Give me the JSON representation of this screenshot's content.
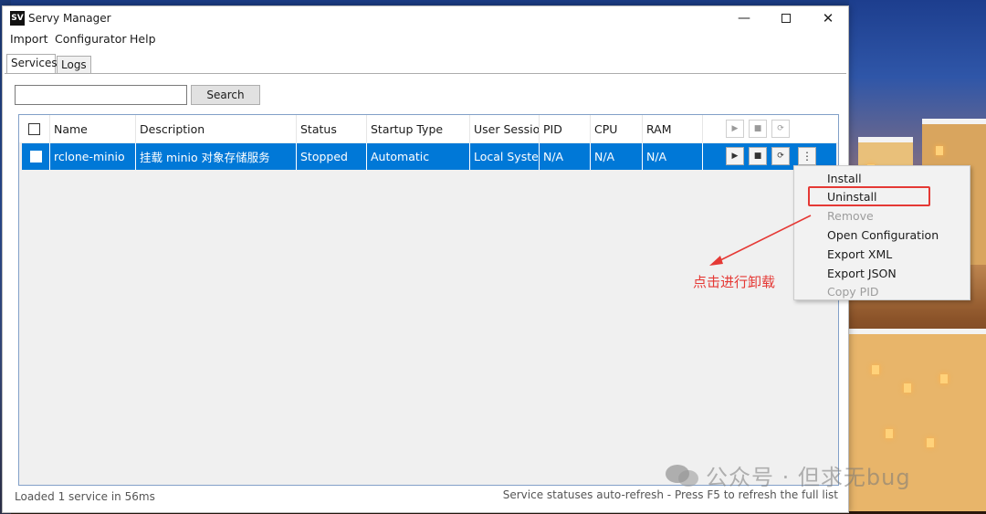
{
  "window": {
    "app_icon_text": "SV",
    "title": "Servy Manager"
  },
  "menubar": {
    "items": [
      "Import",
      "Configurator",
      "Help"
    ]
  },
  "tabs": [
    {
      "label": "Services",
      "active": true
    },
    {
      "label": "Logs",
      "active": false
    }
  ],
  "search": {
    "value": "",
    "button_label": "Search"
  },
  "grid": {
    "columns": [
      "Name",
      "Description",
      "Status",
      "Startup Type",
      "User Session",
      "PID",
      "CPU",
      "RAM"
    ],
    "rows": [
      {
        "name": "rclone-minio",
        "description": "挂载 minio 对象存储服务",
        "status": "Stopped",
        "startup_type": "Automatic",
        "user_session": "Local System",
        "pid": "N/A",
        "cpu": "N/A",
        "ram": "N/A",
        "selected": true
      }
    ],
    "row_controls": [
      "play-icon",
      "stop-icon",
      "restart-icon",
      "more-icon"
    ]
  },
  "context_menu": {
    "items": [
      {
        "label": "Install",
        "enabled": true
      },
      {
        "label": "Uninstall",
        "enabled": true,
        "highlighted": true
      },
      {
        "label": "Remove",
        "enabled": false
      },
      {
        "label": "Open Configuration",
        "enabled": true
      },
      {
        "label": "Export XML",
        "enabled": true
      },
      {
        "label": "Export JSON",
        "enabled": true
      },
      {
        "label": "Copy PID",
        "enabled": false
      }
    ]
  },
  "annotation": {
    "text": "点击进行卸载",
    "color": "#e53935"
  },
  "status": {
    "left": "Loaded 1 service in 56ms",
    "right": "Service statuses auto-refresh - Press F5 to refresh the full list"
  },
  "watermark": {
    "text": "公众号 · 但求无bug"
  },
  "colors": {
    "selection": "#0078d7",
    "accent_red": "#e53935"
  }
}
